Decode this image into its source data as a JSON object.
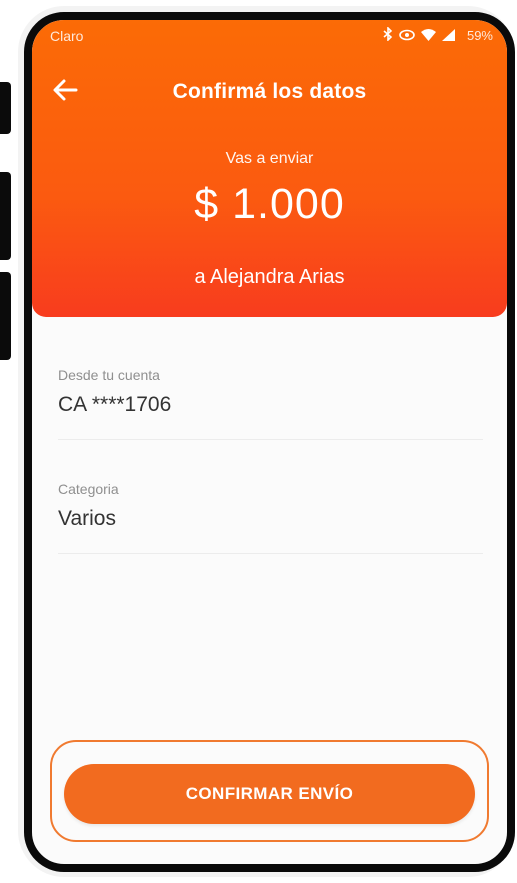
{
  "status_bar": {
    "carrier": "Claro",
    "battery": "59%",
    "icons": [
      "bluetooth-icon",
      "eye-icon",
      "wifi-icon",
      "signal-icon"
    ]
  },
  "header": {
    "title": "Confirmá los datos",
    "sending_label": "Vas a enviar",
    "amount": "$ 1.000",
    "recipient": "a Alejandra Arias"
  },
  "details": {
    "account_label": "Desde tu cuenta",
    "account_value": "CA ****1706",
    "category_label": "Categoria",
    "category_value": "Varios"
  },
  "actions": {
    "confirm_label": "CONFIRMAR ENVÍO"
  },
  "colors": {
    "header_orange": "#fb6b06",
    "header_red": "#f83c1e",
    "button": "#f26b1f"
  }
}
